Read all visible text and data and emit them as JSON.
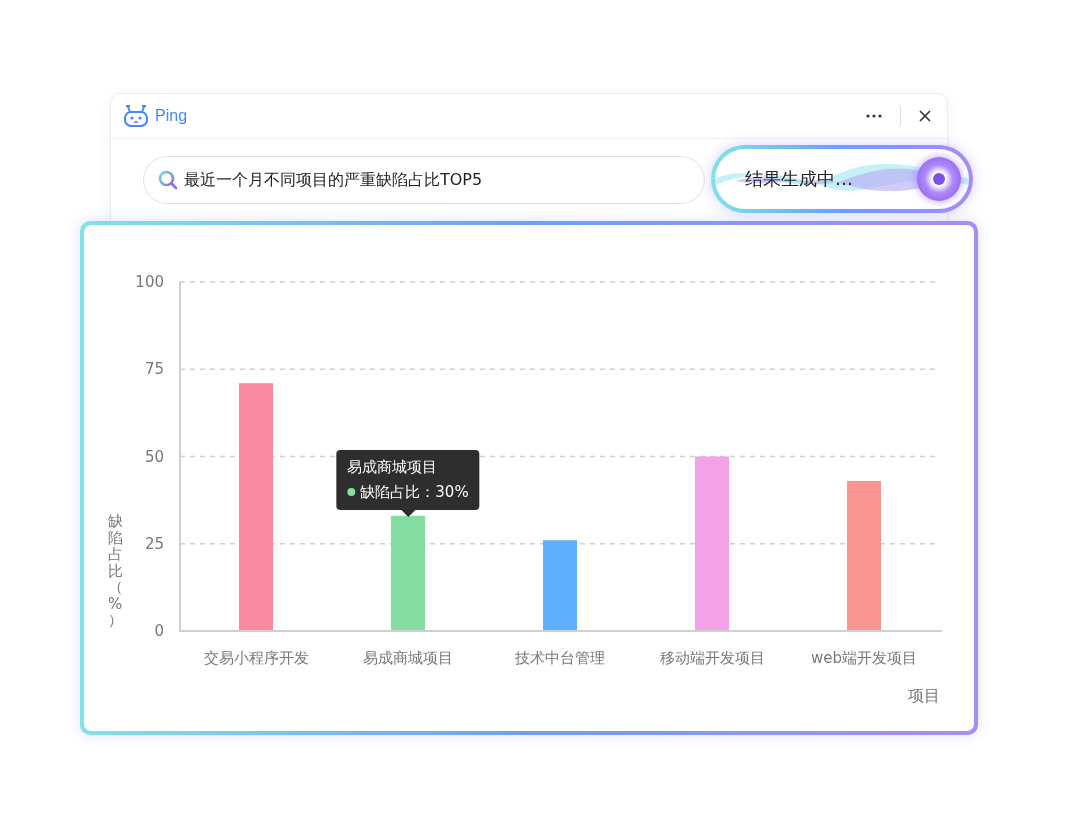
{
  "window": {
    "app_name": "Ping"
  },
  "search": {
    "value": "最近一个月不同项目的严重缺陷占比TOP5"
  },
  "status_pill": {
    "label": "结果生成中…"
  },
  "chart": {
    "chart_data": {
      "type": "bar",
      "xlabel": "项目",
      "ylabel": "缺陷占比（%）",
      "series": [
        {
          "name": "交易小程序开发",
          "color": "#f98aa0",
          "values": [
            71,
            null,
            null,
            null,
            null
          ]
        },
        {
          "name": "易成商城项目",
          "color": "#84dda0",
          "values": [
            null,
            33,
            null,
            null,
            null
          ]
        },
        {
          "name": "技术中台管理",
          "color": "#5eb0fc",
          "values": [
            null,
            null,
            26,
            null,
            null
          ]
        },
        {
          "name": "移动端开发项目",
          "color": "#f4a2e8",
          "values": [
            null,
            null,
            null,
            50,
            null
          ]
        },
        {
          "name": "web端开发项目",
          "color": "#f99590",
          "values": [
            null,
            null,
            null,
            null,
            43
          ]
        }
      ],
      "stacked": true,
      "grid": true,
      "ylim": [
        0,
        100
      ],
      "yticks": [
        0,
        25,
        50,
        75,
        100
      ]
    },
    "tooltip": {
      "title": "易成商城项目",
      "label": "缺陷占比：30%",
      "color": "#84dda0"
    }
  }
}
